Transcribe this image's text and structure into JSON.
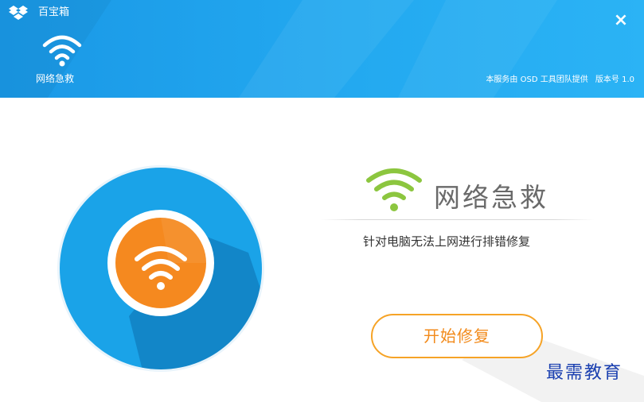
{
  "header": {
    "app_title": "百宝箱",
    "tool_label": "网络急救",
    "credit_text": "本服务由 OSD 工具团队提供",
    "version_text": "版本号 1.0",
    "close_glyph": "×",
    "accent_color": "#23a9f0"
  },
  "main": {
    "title": "网络急救",
    "subtitle": "针对电脑无法上网进行排错修复",
    "start_button_label": "开始修复",
    "colors": {
      "badge_blue": "#1aa3e8",
      "badge_orange": "#f5891f",
      "wifi_green": "#8cc63f",
      "button_orange": "#f6a326"
    }
  },
  "watermark": {
    "text": "最需教育"
  }
}
